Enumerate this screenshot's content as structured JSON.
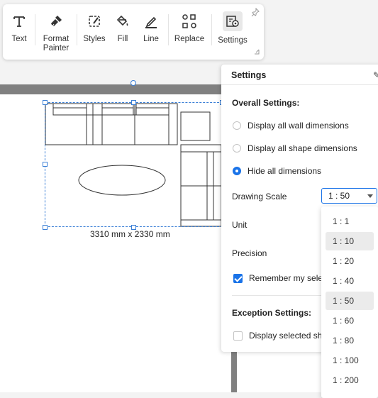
{
  "toolbar": {
    "items": [
      {
        "label": "Text",
        "icon": "text-icon"
      },
      {
        "label": "Format\nPainter",
        "icon": "format-painter-icon"
      },
      {
        "label": "Styles",
        "icon": "styles-icon"
      },
      {
        "label": "Fill",
        "icon": "fill-bucket-icon"
      },
      {
        "label": "Line",
        "icon": "line-pen-icon"
      },
      {
        "label": "Replace",
        "icon": "replace-icon"
      },
      {
        "label": "Settings",
        "icon": "settings-icon"
      }
    ]
  },
  "canvas": {
    "dimension_label": "3310 mm x 2330 mm"
  },
  "settings_panel": {
    "title": "Settings",
    "overall_heading": "Overall Settings:",
    "dimension_options": [
      {
        "label": "Display all wall dimensions",
        "checked": false
      },
      {
        "label": "Display all shape dimensions",
        "checked": false
      },
      {
        "label": "Hide all dimensions",
        "checked": true
      }
    ],
    "drawing_scale_label": "Drawing Scale",
    "drawing_scale_value": "1 : 50",
    "unit_label": "Unit",
    "precision_label": "Precision",
    "remember_label": "Remember my sele",
    "remember_checked": true,
    "exception_heading": "Exception Settings:",
    "display_selected_label": "Display selected sha",
    "display_selected_checked": false
  },
  "scale_dropdown": {
    "options": [
      "1 : 1",
      "1 : 10",
      "1 : 20",
      "1 : 40",
      "1 : 50",
      "1 : 60",
      "1 : 80",
      "1 : 100",
      "1 : 200"
    ],
    "selected": "1 : 50",
    "hovered": "1 : 10"
  },
  "colors": {
    "accent": "#1a73e8",
    "selection": "#3a7fd6",
    "wall": "#808080"
  }
}
